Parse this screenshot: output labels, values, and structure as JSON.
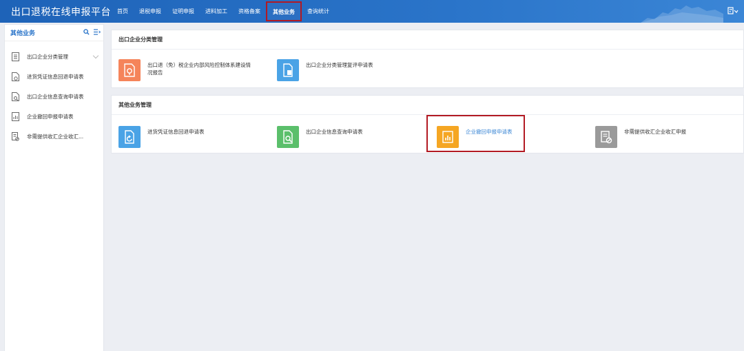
{
  "header": {
    "title": "出口退税在线申报平台",
    "nav": [
      "首页",
      "退税申报",
      "证明申报",
      "进料加工",
      "资格备案",
      "其他业务",
      "查询统计"
    ],
    "active_nav": "其他业务"
  },
  "sidebar": {
    "title": "其他业务",
    "items": [
      {
        "label": "出口企业分类管理"
      },
      {
        "label": "进货凭证信息回退申请表"
      },
      {
        "label": "出口企业信息查询申请表"
      },
      {
        "label": "企业撤回申报申请表"
      },
      {
        "label": "非需提供收汇企业收汇..."
      }
    ]
  },
  "sections": [
    {
      "title": "出口企业分类管理",
      "cards": [
        {
          "label_line1": "出口退（免）税企业内部风险控制体系建设情",
          "label_line2": "况报告",
          "color": "#f5845a",
          "icon": "report-icon"
        },
        {
          "label_line1": "出口企业分类管理复评申请表",
          "label_line2": "",
          "color": "#4aa3e6",
          "icon": "document-icon"
        }
      ]
    },
    {
      "title": "其他业务管理",
      "cards": [
        {
          "label_line1": "进货凭证信息回退申请表",
          "label_line2": "",
          "color": "#4aa3e6",
          "icon": "rollback-icon"
        },
        {
          "label_line1": "出口企业信息查询申请表",
          "label_line2": "",
          "color": "#5bbf6b",
          "icon": "search-doc-icon"
        },
        {
          "label_line1": "企业撤回申报申请表",
          "label_line2": "",
          "color": "#f5a623",
          "icon": "chart-doc-icon"
        },
        {
          "label_line1": "非需提供收汇企业收汇申报",
          "label_line2": "",
          "color": "#9a9a9a",
          "icon": "no-doc-icon"
        }
      ]
    }
  ]
}
